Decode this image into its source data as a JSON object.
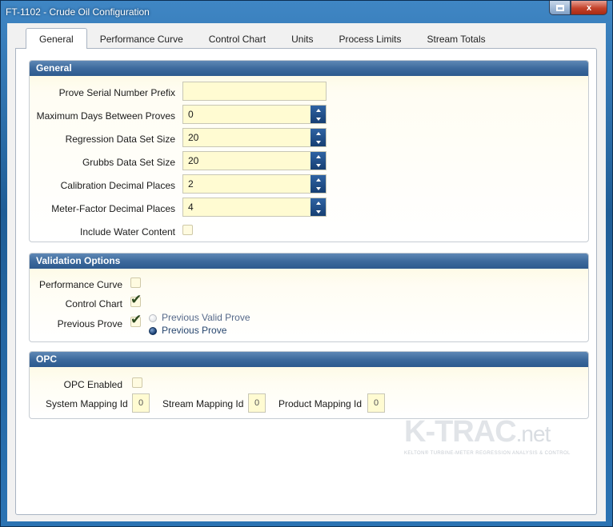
{
  "window": {
    "title": "FT-1102 - Crude Oil Configuration",
    "close_glyph": "x"
  },
  "tabs": [
    {
      "label": "General",
      "active": true
    },
    {
      "label": "Performance Curve"
    },
    {
      "label": "Control Chart"
    },
    {
      "label": "Units"
    },
    {
      "label": "Process Limits"
    },
    {
      "label": "Stream Totals"
    }
  ],
  "general": {
    "header": "General",
    "prove_prefix_label": "Prove Serial Number Prefix",
    "prove_prefix_value": "",
    "max_days_label": "Maximum Days Between Proves",
    "max_days_value": "0",
    "regression_label": "Regression Data Set Size",
    "regression_value": "20",
    "grubbs_label": "Grubbs Data Set Size",
    "grubbs_value": "20",
    "calibration_label": "Calibration Decimal Places",
    "calibration_value": "2",
    "meter_factor_label": "Meter-Factor Decimal Places",
    "meter_factor_value": "4",
    "water_label": "Include Water Content",
    "water_checked": false
  },
  "validation": {
    "header": "Validation Options",
    "performance_label": "Performance Curve",
    "performance_checked": false,
    "control_label": "Control Chart",
    "control_checked": true,
    "previous_label": "Previous Prove",
    "previous_checked": true,
    "radio_valid_label": "Previous Valid Prove",
    "radio_prev_label": "Previous Prove",
    "radio_selected": "Previous Prove",
    "check_glyph": "✔"
  },
  "opc": {
    "header": "OPC",
    "enabled_label": "OPC Enabled",
    "enabled_checked": false,
    "system_label": "System Mapping Id",
    "system_value": "0",
    "stream_label": "Stream Mapping Id",
    "stream_value": "0",
    "product_label": "Product Mapping Id",
    "product_value": "0"
  },
  "logo": {
    "main": "K-TRAC",
    "suffix": ".net",
    "tagline": "KELTON® TURBINE-METER REGRESSION ANALYSIS & CONTROL"
  },
  "colors": {
    "header_blue": "#3d6a9d",
    "input_yellow": "#fffbd2",
    "spinner_blue": "#163f73"
  }
}
